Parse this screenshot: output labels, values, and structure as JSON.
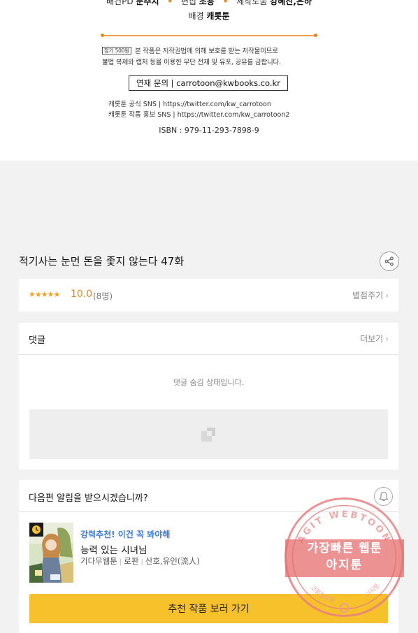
{
  "credits": {
    "cut_line": {
      "role1": "배컨PD",
      "name1": "문주지",
      "role2": "편집",
      "name2": "조용",
      "role3": "제작도움",
      "name3": "강혜진,은하"
    },
    "background_label": "배경",
    "background_name": "캐롯툰",
    "price_tag": "정가 500원",
    "copyright_line1": "본 작품은 저작권법에 의해 보호를 받는 저작물이므로",
    "copyright_line2": "불법 복제와 캡처 등을 이용한 무단 전재 및 유포, 공유를 금합니다.",
    "contact": "연재 문의 | carrotoon@kwbooks.co.kr",
    "sns_official": "캐롯툰 공식 SNS | https://twitter.com/kw_carrotoon",
    "sns_promo": "캐롯툰 작품 홍보 SNS | https://twitter.com/kw_carrotoon2",
    "isbn": "ISBN : 979-11-293-7898-9"
  },
  "episode": {
    "title": "적기사는 눈먼 돈을 좇지 않는다 47화",
    "share_icon": "share-icon"
  },
  "rating": {
    "stars": "★★★★★",
    "score": "10.0",
    "count": "(8명)",
    "rate_label": "별점주기"
  },
  "comments": {
    "header": "댓글",
    "more_label": "더보기",
    "hidden_message": "댓글 숨김 상태입니다."
  },
  "notify": {
    "question": "다음편 알림을 받으시겠습니까?",
    "recommend_label": "강력추천! 이건 꼭 봐야해",
    "rec_title": "능력 있는 시녀님",
    "rec_meta": [
      "기다무웹툰",
      "로판",
      "산호,유인(流人)"
    ],
    "cta_label": "추천 작품 보러 가기"
  },
  "watermark": {
    "arc_top": "AGIT WEBTOON",
    "line1": "가장빠른 웹툰",
    "line2": "아지툰",
    "arc_bottom_left": "고품질무료",
    "arc_bottom_right": "아지툰"
  },
  "colors": {
    "accent_orange": "#e8841c",
    "star_color": "#f0a01e",
    "cta_yellow": "#f7c12c",
    "link_blue": "#3a7be0",
    "stamp_red": "#e66e6e"
  }
}
